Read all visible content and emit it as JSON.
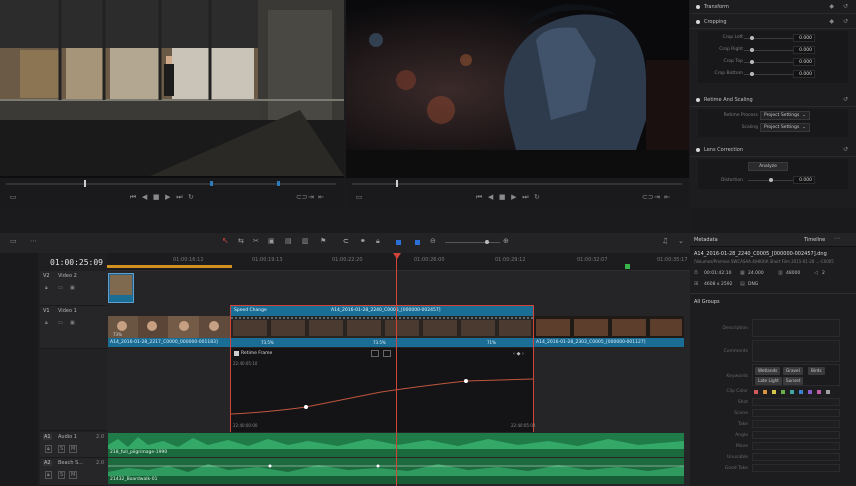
{
  "inspector": {
    "transform_title": "Transform",
    "cropping_title": "Cropping",
    "crop_params": [
      {
        "label": "Crop Left",
        "value": "0.000"
      },
      {
        "label": "Crop Right",
        "value": "0.000"
      },
      {
        "label": "Crop Top",
        "value": "0.000"
      },
      {
        "label": "Crop Bottom",
        "value": "0.000"
      }
    ],
    "retime_title": "Retime And Scaling",
    "retime_process_label": "Retime Process",
    "retime_process_value": "Project Settings",
    "scaling_label": "Scaling",
    "scaling_value": "Project Settings",
    "lens_title": "Lens Correction",
    "analyze_label": "Analyze",
    "distortion_label": "Distortion",
    "distortion_value": "0.000"
  },
  "timeline": {
    "timecode": "01:00:25:09",
    "ruler": [
      "01:00:16:12",
      "01:00:19:13",
      "01:00:22:20",
      "01:00:26:00",
      "01:00:29:12",
      "01:00:32:07",
      "01:00:35:17"
    ],
    "tracks": {
      "v2": {
        "id": "V2",
        "name": "Video 2"
      },
      "v1": {
        "id": "V1",
        "name": "Video 1"
      },
      "a1": {
        "id": "A1",
        "name": "Audio 1",
        "ch": "2.0"
      },
      "a2": {
        "id": "A2",
        "name": "Beach S...",
        "ch": "2.0"
      }
    },
    "clips": {
      "left_video": "A14_2016-01-28_2217_C0000_000000-001183]",
      "speed_change": "Speed Change",
      "center_video": "A14_2016-01-28_2240_C0005_[000000-002457]",
      "right_video": "A14_2016-01-28_2303_C0005_[000000-001127]",
      "pct_center1": "73.5%",
      "pct_center2": "73.5%",
      "pct_right": "71%",
      "pct_left": "73%",
      "retime_frame": "Retime Frame",
      "retime_top": "22:40:05:10",
      "retime_bottom": "22:40:00:00",
      "retime_bottom_right": "22:40:05:04",
      "audio1": "218_full_pilgrimage-1990",
      "audio2": "21432_Boardwalk-01"
    }
  },
  "metadata": {
    "tab_metadata": "Metadata",
    "tab_timeline": "Timeline",
    "filename": "A14_2016-01-28_2240_C0005_[000000-002457].dng",
    "path": "/Volumes/Promise SWCASAA.4/HKXIA Short Film 2015-01-28 ...-C0005",
    "duration": "00:01:42:10",
    "fps": "24.000",
    "frames": "48000",
    "channels": "2",
    "resolution": "4608 x 2592",
    "codec": "DNG",
    "group": "All Groups",
    "fields": [
      "Description",
      "Comments",
      "Keywords",
      "Clip Color",
      "Shot",
      "Scene",
      "Take",
      "Angle",
      "Move",
      "Unusable",
      "Good Take"
    ],
    "keywords": [
      "Wetlands",
      "Gravel",
      "Birds",
      "Late Light",
      "Sunset"
    ],
    "clip_colors": [
      "#d35a5a",
      "#d8943a",
      "#d7c64a",
      "#67b04b",
      "#3fa6a0",
      "#3d7fd0",
      "#8a5cc9",
      "#c05ca8",
      "#a0a0a0"
    ]
  }
}
